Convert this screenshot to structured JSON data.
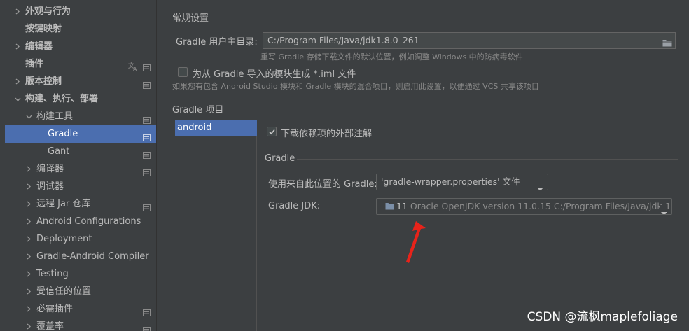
{
  "sidebar": {
    "items": [
      {
        "label": "外观与行为",
        "expandable": true
      },
      {
        "label": "按键映射",
        "expandable": false
      },
      {
        "label": "编辑器",
        "expandable": true
      },
      {
        "label": "插件",
        "expandable": false
      },
      {
        "label": "版本控制",
        "expandable": true
      },
      {
        "label": "构建、执行、部署",
        "expandable": true,
        "expanded": true
      },
      {
        "label": "构建工具",
        "expandable": true,
        "expanded": true
      },
      {
        "label": "Gradle",
        "selected": true
      },
      {
        "label": "Gant"
      },
      {
        "label": "编译器",
        "expandable": true
      },
      {
        "label": "调试器",
        "expandable": true
      },
      {
        "label": "远程 Jar 仓库",
        "expandable": true
      },
      {
        "label": "Android Configurations",
        "expandable": true
      },
      {
        "label": "Deployment",
        "expandable": true
      },
      {
        "label": "Gradle-Android Compiler",
        "expandable": true
      },
      {
        "label": "Testing",
        "expandable": true
      },
      {
        "label": "受信任的位置",
        "expandable": true
      },
      {
        "label": "必需插件",
        "expandable": true
      },
      {
        "label": "覆盖率",
        "expandable": true
      }
    ]
  },
  "general": {
    "section_title": "常规设置",
    "user_home_label": "Gradle 用户主目录:",
    "user_home_value": "C:/Program Files/Java/jdk1.8.0_261",
    "user_home_hint": "重写 Gradle 存储下载文件的默认位置，例如调整 Windows 中的防病毒软件",
    "iml_checkbox_label": "为从 Gradle 导入的模块生成 *.iml 文件",
    "iml_checked": false,
    "iml_hint": "如果您有包含 Android Studio 模块和 Gradle 模块的混合项目，则启用此设置，以便通过 VCS 共享该项目"
  },
  "projects": {
    "section_title": "Gradle 项目",
    "items": [
      "android"
    ]
  },
  "project_settings": {
    "download_annotations_label": "下载依赖项的外部注解",
    "download_annotations_checked": true,
    "gradle_section_title": "Gradle",
    "use_gradle_from_label": "使用来自此位置的 Gradle:",
    "use_gradle_from_value": "'gradle-wrapper.properties' 文件",
    "gradle_jdk_label": "Gradle JDK:",
    "gradle_jdk_version": "11",
    "gradle_jdk_value": "Oracle OpenJDK version 11.0.15 C:/Program Files/Java/jdk-1"
  },
  "watermark": "CSDN @流枫maplefoliage",
  "colors": {
    "background": "#3c3f41",
    "selection": "#4b6eaf",
    "annotation_arrow": "#e8231a"
  }
}
